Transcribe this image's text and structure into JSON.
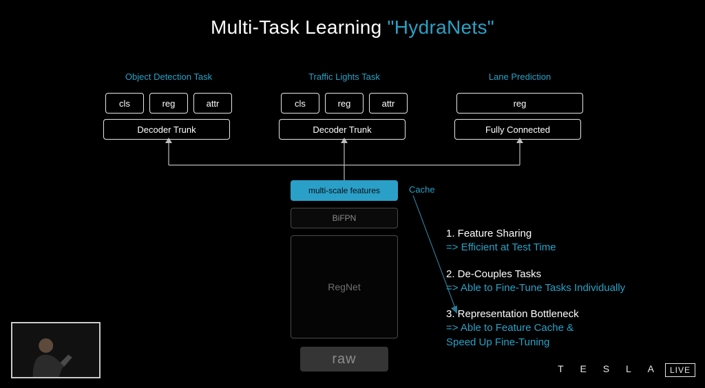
{
  "title": {
    "prefix": "Multi-Task Learning ",
    "term": "\"HydraNets\""
  },
  "tasks": [
    {
      "label": "Object Detection Task",
      "heads": [
        "cls",
        "reg",
        "attr"
      ],
      "trunk": "Decoder Trunk"
    },
    {
      "label": "Traffic Lights Task",
      "heads": [
        "cls",
        "reg",
        "attr"
      ],
      "trunk": "Decoder Trunk"
    },
    {
      "label": "Lane Prediction",
      "heads": [
        "reg"
      ],
      "trunk": "Fully Connected"
    }
  ],
  "stack": {
    "features": "multi-scale features",
    "cache": "Cache",
    "bifpn": "BiFPN",
    "regnet": "RegNet",
    "raw": "raw"
  },
  "benefits": [
    {
      "head": "1. Feature Sharing",
      "sub": "=> Efficient at Test Time"
    },
    {
      "head": "2. De-Couples Tasks",
      "sub": "=> Able to Fine-Tune Tasks Individually"
    },
    {
      "head": "3. Representation Bottleneck",
      "sub": "=> Able to Feature Cache &\nSpeed Up Fine-Tuning"
    }
  ],
  "footer": {
    "brand": "T E S L A",
    "live": "LIVE"
  }
}
